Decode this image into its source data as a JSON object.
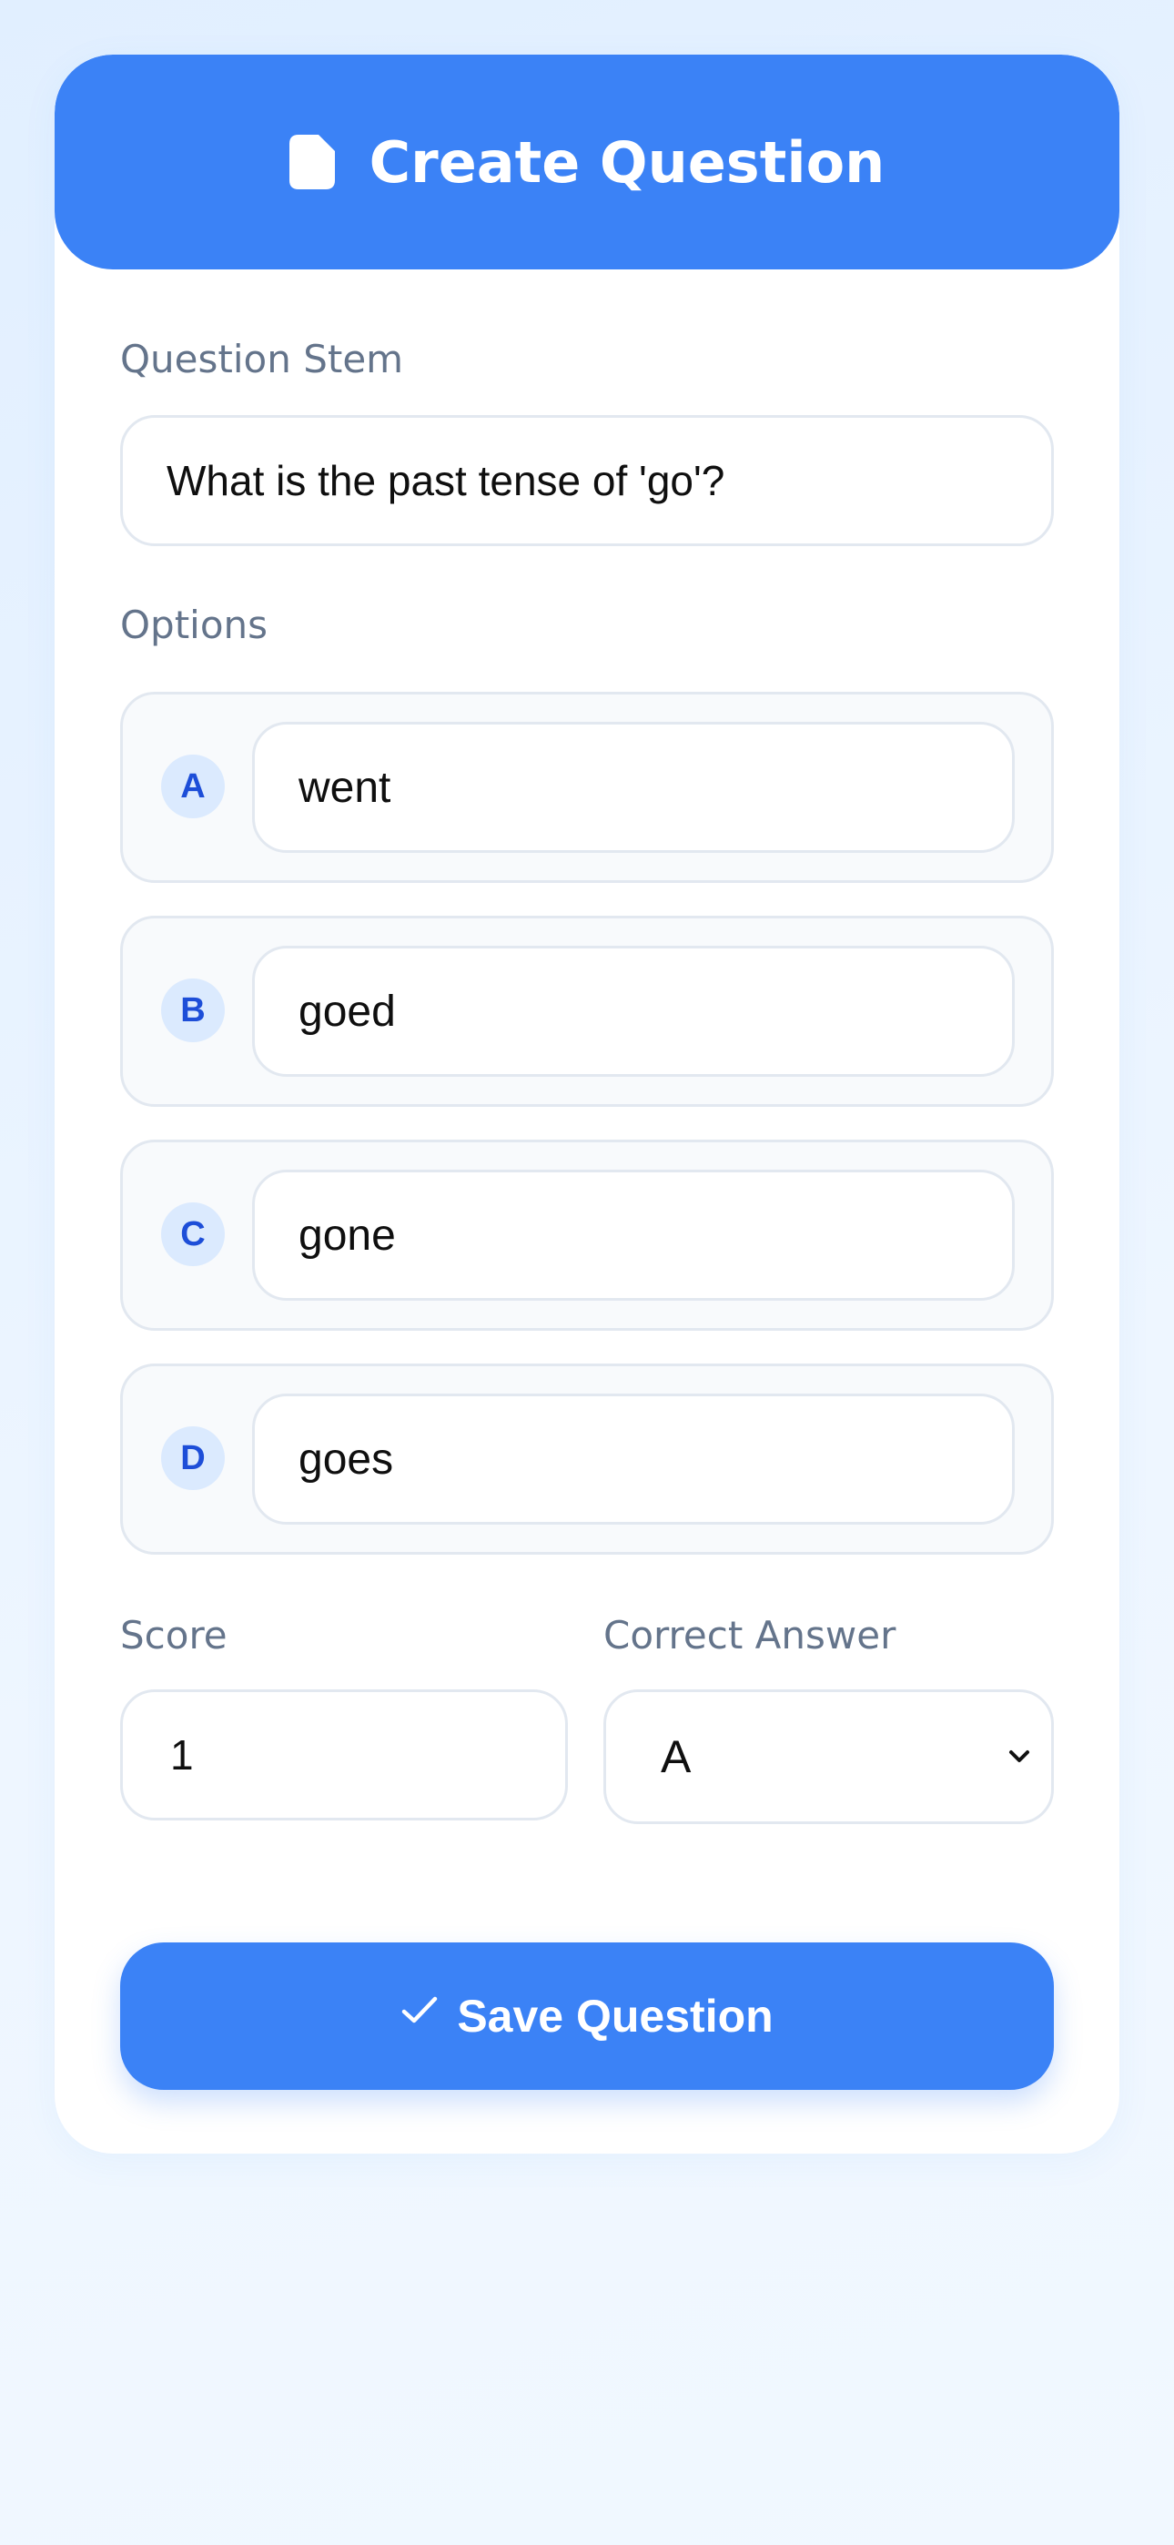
{
  "header": {
    "title": "Create Question",
    "icon": "document-icon"
  },
  "question_stem": {
    "label": "Question Stem",
    "value": "What is the past tense of 'go'?"
  },
  "options": {
    "label": "Options",
    "items": [
      {
        "letter": "A",
        "value": "went"
      },
      {
        "letter": "B",
        "value": "goed"
      },
      {
        "letter": "C",
        "value": "gone"
      },
      {
        "letter": "D",
        "value": "goes"
      }
    ]
  },
  "score": {
    "label": "Score",
    "value": "1"
  },
  "correct_answer": {
    "label": "Correct Answer",
    "selected": "A"
  },
  "save_button": {
    "label": "Save Question",
    "icon": "check-icon"
  },
  "colors": {
    "primary": "#3b82f6",
    "badge_bg": "#dbeafe",
    "badge_text": "#1d4ed8",
    "label_text": "#64748b",
    "border": "#e2e8f0"
  }
}
